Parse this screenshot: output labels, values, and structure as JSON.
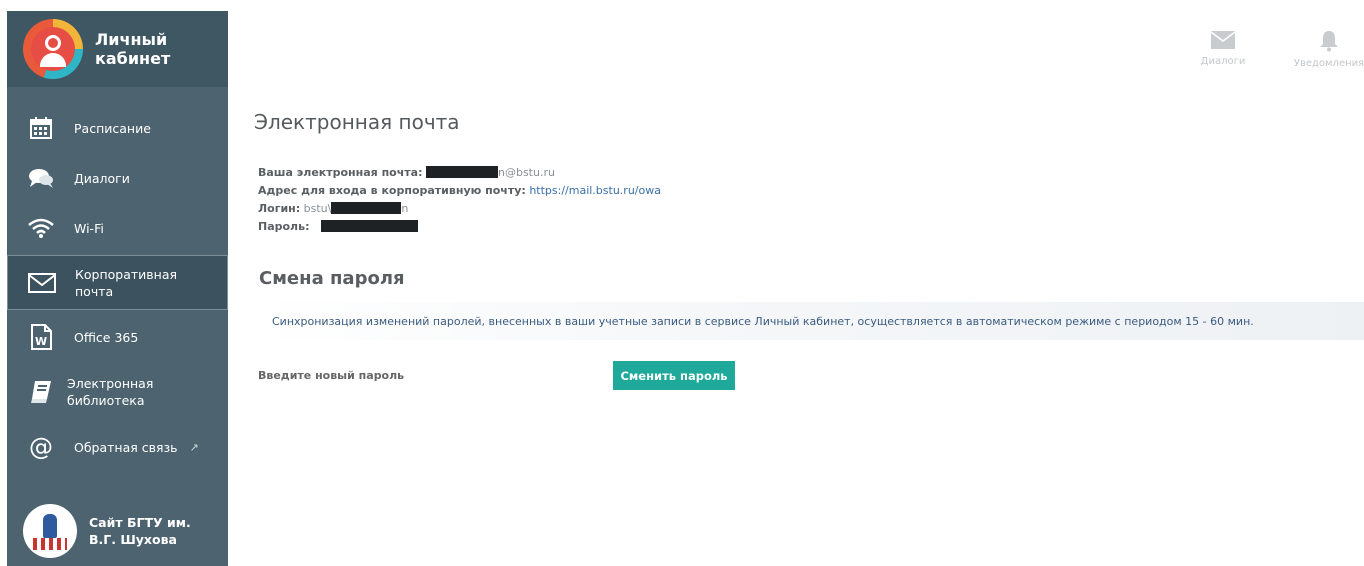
{
  "brand": {
    "title": "Личный кабинет"
  },
  "sidebar": {
    "items": [
      {
        "label": "Расписание",
        "icon": "calendar-icon"
      },
      {
        "label": "Диалоги",
        "icon": "chat-icon"
      },
      {
        "label": "Wi-Fi",
        "icon": "wifi-icon"
      },
      {
        "label": "Корпоративная почта",
        "icon": "envelope-icon",
        "active": true
      },
      {
        "label": "Office 365",
        "icon": "word-document-icon"
      },
      {
        "label": "Электронная библиотека",
        "icon": "book-icon"
      },
      {
        "label": "Обратная связь",
        "icon": "at-sign-icon",
        "external": true
      }
    ],
    "site": {
      "label": "Сайт БГТУ им. В.Г. Шухова"
    }
  },
  "header": {
    "dialogs_label": "Диалоги",
    "notifications_label": "Уведомления"
  },
  "email": {
    "title": "Электронная почта",
    "your_email_label": "Ваша электронная почта:",
    "your_email_suffix": "n@bstu.ru",
    "corp_login_label": "Адрес для входа в корпоративную почту:",
    "corp_login_url": "https://mail.bstu.ru/owa",
    "login_label": "Логин:",
    "login_prefix": "bstu\\",
    "login_suffix": "n",
    "password_label": "Пароль:"
  },
  "password_change": {
    "title": "Смена пароля",
    "sync_notice": "Синхронизация изменений паролей, внесенных в ваши учетные записи в сервисе Личный кабинет, осуществляется в автоматическом режиме с периодом 15 - 60 мин.",
    "new_password_label": "Введите новый пароль",
    "button_label": "Сменить пароль"
  },
  "colors": {
    "sidebar": "#4d6470",
    "button": "#1fa99b",
    "link": "#3b6fa8"
  }
}
